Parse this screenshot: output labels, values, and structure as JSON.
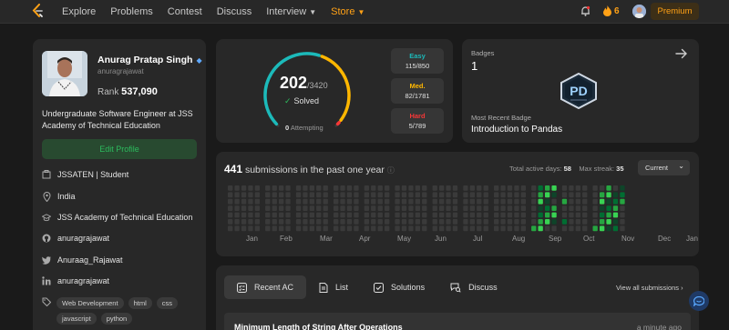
{
  "nav": {
    "links": [
      "Explore",
      "Problems",
      "Contest",
      "Discuss",
      "Interview",
      "Store"
    ],
    "streak": "6",
    "premium": "Premium"
  },
  "profile": {
    "name": "Anurag Pratap Singh",
    "username": "anuragrajawat",
    "rank_label": "Rank",
    "rank": "537,090",
    "bio": "Undergraduate Software Engineer at JSS Academy of Technical Education",
    "edit": "Edit Profile",
    "info": [
      "JSSATEN | Student",
      "India",
      "JSS Academy of Technical Education",
      "anuragrajawat",
      "Anuraag_Rajawat",
      "anuragrajawat"
    ],
    "skills": [
      "Web Development",
      "html",
      "css",
      "javascript",
      "python"
    ]
  },
  "solved": {
    "count": "202",
    "total": "/3420",
    "label": "Solved",
    "attempting_count": "0",
    "attempting_label": "Attempting",
    "easy_label": "Easy",
    "easy": "115/850",
    "med_label": "Med.",
    "med": "82/1781",
    "hard_label": "Hard",
    "hard": "5/789",
    "colors": {
      "easy": "#1cbaba",
      "med": "#ffb700",
      "hard": "#f63737"
    }
  },
  "badges": {
    "label": "Badges",
    "count": "1",
    "recent_label": "Most Recent Badge",
    "recent_name": "Introduction to Pandas",
    "badge_text": "PD"
  },
  "calendar": {
    "count": "441",
    "text": "submissions in the past one year",
    "active_label": "Total active days:",
    "active": "58",
    "streak_label": "Max streak:",
    "streak": "35",
    "select": "Current",
    "months": [
      "Jan",
      "Feb",
      "Mar",
      "Apr",
      "May",
      "Jun",
      "Jul",
      "Aug",
      "Sep",
      "Oct",
      "Nov",
      "Dec",
      "Jan"
    ]
  },
  "recent": {
    "tabs": [
      "Recent AC",
      "List",
      "Solutions",
      "Discuss"
    ],
    "view_all": "View all submissions",
    "first_problem": "Minimum Length of String After Operations",
    "first_time": "a minute ago"
  }
}
